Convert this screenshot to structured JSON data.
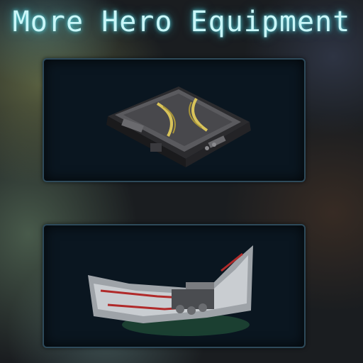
{
  "header": {
    "title": "More Hero Equipment"
  },
  "items": [
    {
      "name": "armor-plate",
      "icon": "chest-armor-icon"
    },
    {
      "name": "forearm-gauntlet",
      "icon": "gauntlet-icon"
    }
  ],
  "colors": {
    "title_glow": "#c9f6f8",
    "panel_bg": "#0a1620",
    "panel_border": "#2e4a5a",
    "accent_yellow": "#d8c35a",
    "accent_red": "#b02a2a"
  }
}
